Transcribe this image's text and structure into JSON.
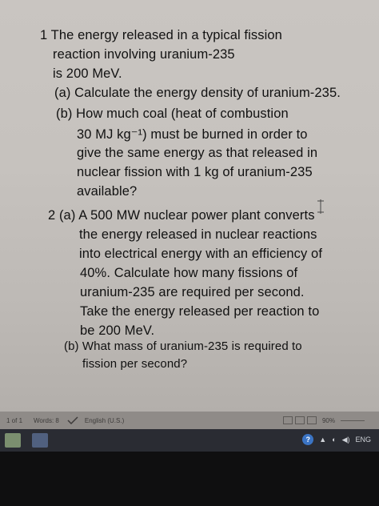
{
  "document": {
    "lines": [
      "1 The energy released in a typical fission",
      "reaction involving uranium-235",
      "is 200 MeV.",
      "(a) Calculate the energy density of uranium-235.",
      "(b) How much coal (heat of combustion",
      "30 MJ kg⁻¹) must be burned in order to",
      "give the same energy as that released in",
      "nuclear fission with 1 kg of uranium-235",
      "available?",
      "2 (a) A 500 MW nuclear power plant converts",
      "the energy released in nuclear reactions",
      "into electrical energy with an efficiency of",
      "40%. Calculate how many fissions of",
      "uranium-235 are required per second.",
      "Take the energy released per reaction to",
      "be 200 MeV.",
      "(b) What mass of uranium-235 is required to",
      "fission per second?"
    ]
  },
  "status_bar": {
    "page": "1 of 1",
    "words": "Words: 8",
    "language": "English (U.S.)",
    "zoom": "90%"
  },
  "taskbar": {
    "language": "ENG"
  }
}
